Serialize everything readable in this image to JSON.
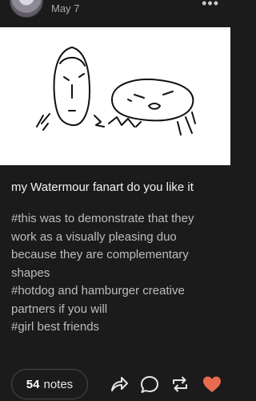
{
  "post": {
    "date": "May 7",
    "caption": "my Watermour fanart do you like it",
    "tags": [
      "#this was to demonstrate that they",
      "work as a visually pleasing duo",
      "because they are complementary",
      "shapes",
      "#hotdog and hamburger creative",
      "partners if you will",
      "#girl best friends"
    ]
  },
  "footer": {
    "notes_count": "54",
    "notes_label": "notes"
  },
  "icons": {
    "more": "more-icon",
    "share": "share-icon",
    "reply": "reply-icon",
    "reblog": "reblog-icon",
    "like": "heart-icon"
  },
  "colors": {
    "background": "#1b1b1b",
    "like": "#e86a4f",
    "text": "#e8e8e8",
    "muted": "#bdbdbd"
  }
}
